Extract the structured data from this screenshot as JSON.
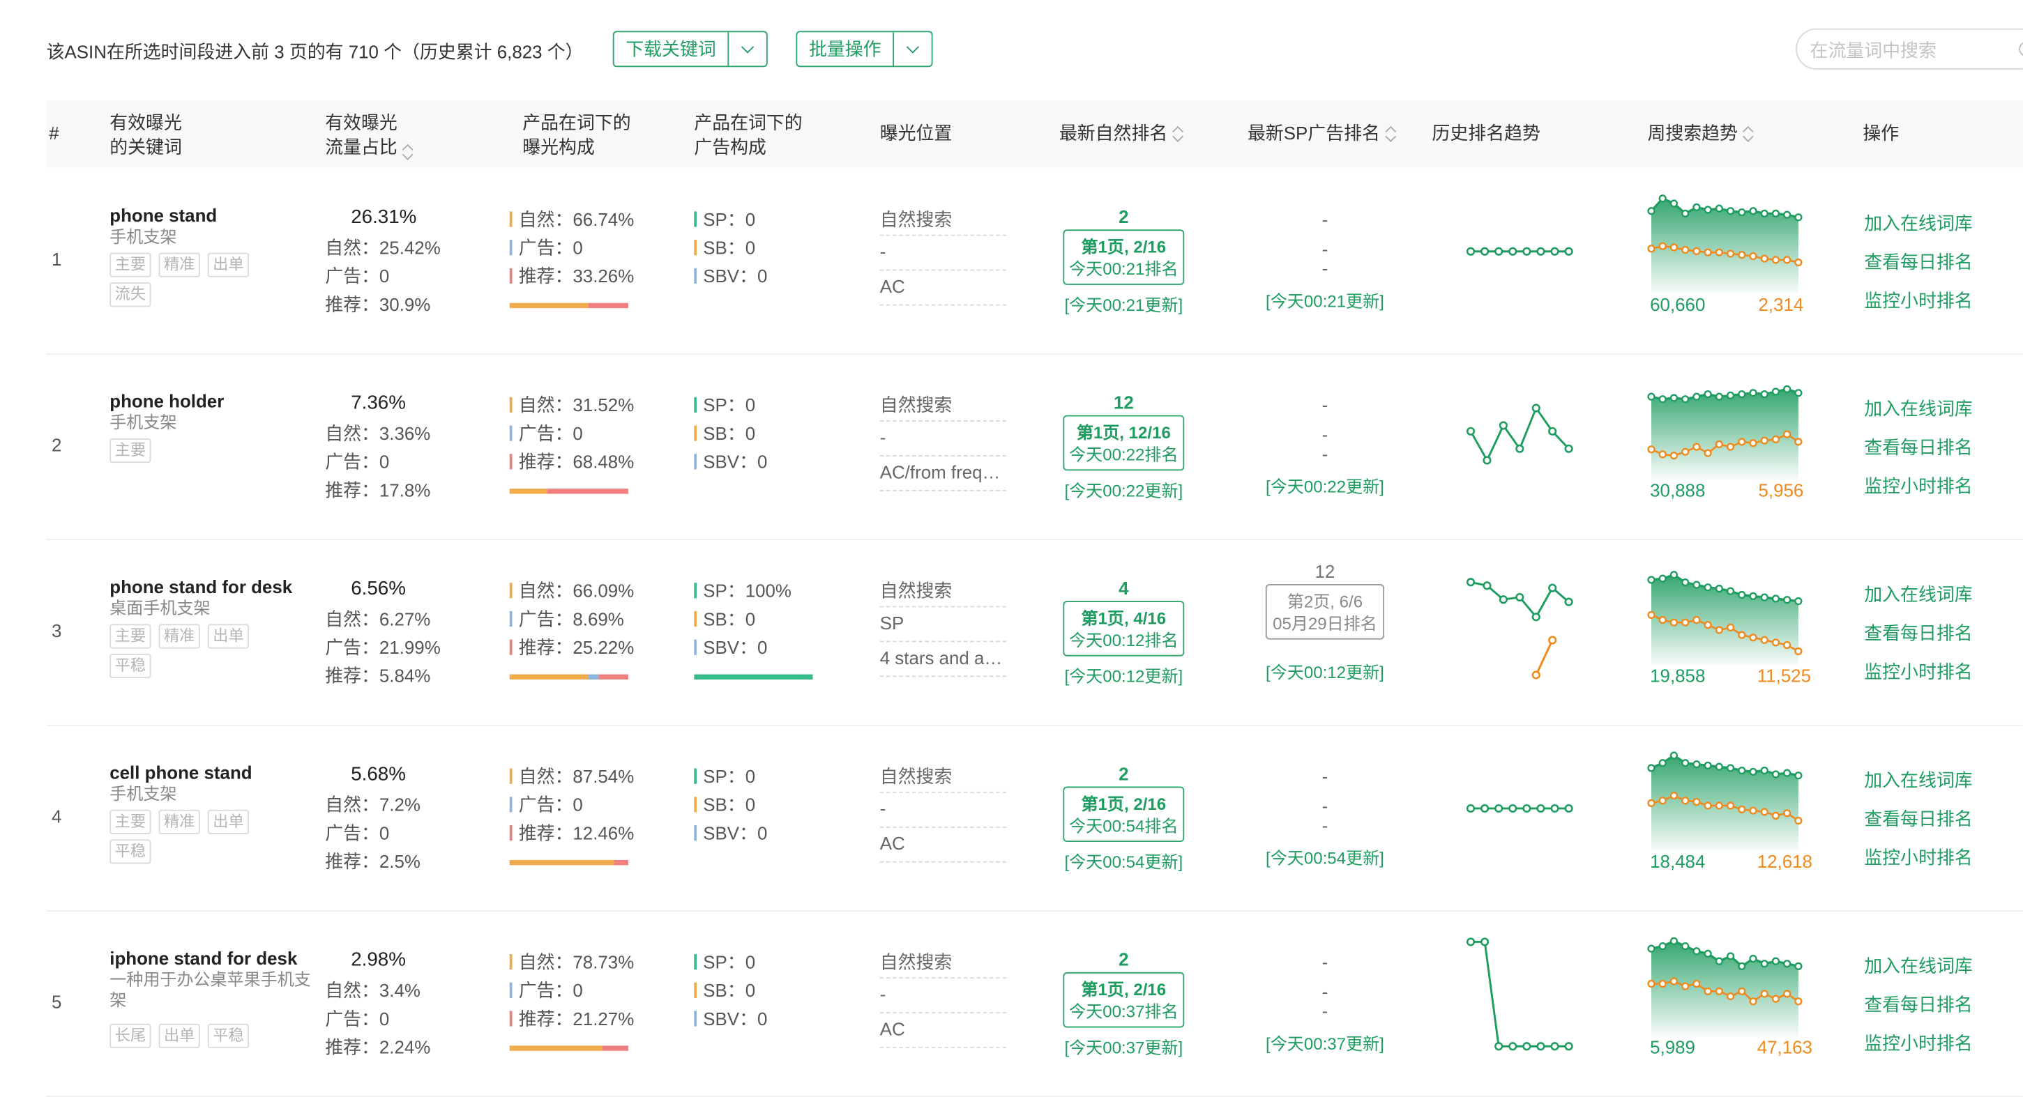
{
  "toolbar": {
    "summary": "该ASIN在所选时间段进入前 3 页的有 710 个（历史累计 6,823 个）",
    "download_label": "下载关键词",
    "batch_label": "批量操作",
    "search_placeholder": "在流量词中搜索"
  },
  "columns": {
    "index": "#",
    "keyword": "有效曝光\n的关键词",
    "share": "有效曝光\n流量占比",
    "exposure": "产品在词下的\n曝光构成",
    "ads": "产品在词下的\n广告构成",
    "position": "曝光位置",
    "organic_rank": "最新自然排名",
    "sp_rank": "最新SP广告排名",
    "history": "历史排名趋势",
    "weekly": "周搜索趋势",
    "actions": "操作"
  },
  "colors": {
    "accent": "#1f9d60",
    "orange": "#ee8a1e",
    "organic": "#f0ab4a",
    "ad": "#8fb4df",
    "recommend": "#f08080",
    "sp_bar": "#37bb8a"
  },
  "rows": [
    {
      "index": "1",
      "keyword": "phone stand",
      "keyword_cn": "手机支架",
      "tags": [
        "主要",
        "精准",
        "出单",
        "流失"
      ],
      "share": "26.31%",
      "share_natural": "自然：25.42%",
      "share_ad": "广告：0",
      "share_rec": "推荐：30.9%",
      "exp_natural": "自然：66.74%",
      "exp_ad": "广告：0",
      "exp_rec": "推荐：33.26%",
      "exp_values": [
        66.74,
        0,
        33.26
      ],
      "sp": "SP：0",
      "sb": "SB：0",
      "sbv": "SBV：0",
      "sp_share": 0,
      "positions": [
        "自然搜索",
        "-",
        "AC"
      ],
      "organic_rank": "2",
      "organic_page": "第1页, 2/16",
      "organic_time": "今天00:21排名",
      "organic_updated": "[今天00:21更新]",
      "sp_rank_lines": [
        "-",
        "-",
        "-"
      ],
      "sp_updated": "[今天00:21更新]",
      "history_green": [
        0.5,
        0.5,
        0.5,
        0.5,
        0.5,
        0.5,
        0.5,
        0.5
      ],
      "history_orange": [],
      "weekly_green": [
        60,
        70,
        66,
        58,
        63,
        61,
        62,
        60,
        59,
        60,
        58,
        58,
        57,
        55
      ],
      "weekly_orange": [
        30,
        32,
        31,
        29,
        28,
        27,
        27,
        26,
        25,
        24,
        22,
        21,
        21,
        19
      ],
      "weekly_volume": "60,660",
      "weekly_rank": "2,314",
      "actions": [
        "加入在线词库",
        "查看每日排名",
        "监控小时排名"
      ]
    },
    {
      "index": "2",
      "keyword": "phone holder",
      "keyword_cn": "手机支架",
      "tags": [
        "主要"
      ],
      "share": "7.36%",
      "share_natural": "自然：3.36%",
      "share_ad": "广告：0",
      "share_rec": "推荐：17.8%",
      "exp_natural": "自然：31.52%",
      "exp_ad": "广告：0",
      "exp_rec": "推荐：68.48%",
      "exp_values": [
        31.52,
        0,
        68.48
      ],
      "sp": "SP：0",
      "sb": "SB：0",
      "sbv": "SBV：0",
      "sp_share": 0,
      "positions": [
        "自然搜索",
        "-",
        "AC/from freq…"
      ],
      "organic_rank": "12",
      "organic_page": "第1页, 12/16",
      "organic_time": "今天00:22排名",
      "organic_updated": "[今天00:22更新]",
      "sp_rank_lines": [
        "-",
        "-",
        "-"
      ],
      "sp_updated": "[今天00:22更新]",
      "history_green": [
        0.55,
        0.3,
        0.6,
        0.4,
        0.75,
        0.55,
        0.4
      ],
      "history_orange": [],
      "weekly_green": [
        60,
        58,
        59,
        58,
        60,
        62,
        60,
        61,
        62,
        63,
        62,
        64,
        66,
        63
      ],
      "weekly_orange": [
        18,
        14,
        13,
        16,
        20,
        15,
        22,
        20,
        24,
        23,
        25,
        26,
        30,
        24
      ],
      "weekly_volume": "30,888",
      "weekly_rank": "5,956",
      "actions": [
        "加入在线词库",
        "查看每日排名",
        "监控小时排名"
      ]
    },
    {
      "index": "3",
      "keyword": "phone stand for desk",
      "keyword_cn": "桌面手机支架",
      "tags": [
        "主要",
        "精准",
        "出单",
        "平稳"
      ],
      "share": "6.56%",
      "share_natural": "自然：6.27%",
      "share_ad": "广告：21.99%",
      "share_rec": "推荐：5.84%",
      "exp_natural": "自然：66.09%",
      "exp_ad": "广告：8.69%",
      "exp_rec": "推荐：25.22%",
      "exp_values": [
        66.09,
        8.69,
        25.22
      ],
      "sp": "SP：100%",
      "sb": "SB：0",
      "sbv": "SBV：0",
      "sp_share": 100,
      "positions": [
        "自然搜索",
        "SP",
        "4 stars and a…"
      ],
      "organic_rank": "4",
      "organic_page": "第1页, 4/16",
      "organic_time": "今天00:12排名",
      "organic_updated": "[今天00:12更新]",
      "sp_rank": "12",
      "sp_page": "第2页, 6/6",
      "sp_time": "05月29日排名",
      "sp_updated": "[今天00:12更新]",
      "history_green": [
        0.85,
        0.82,
        0.7,
        0.72,
        0.55,
        0.8,
        0.68
      ],
      "history_orange": [
        0,
        0,
        0,
        0,
        0.05,
        0.35,
        0
      ],
      "weekly_green": [
        62,
        63,
        66,
        60,
        58,
        56,
        55,
        53,
        50,
        49,
        48,
        47,
        46,
        45
      ],
      "weekly_orange": [
        34,
        30,
        28,
        28,
        30,
        26,
        22,
        24,
        18,
        16,
        14,
        12,
        10,
        5
      ],
      "weekly_volume": "19,858",
      "weekly_rank": "11,525",
      "actions": [
        "加入在线词库",
        "查看每日排名",
        "监控小时排名"
      ]
    },
    {
      "index": "4",
      "keyword": "cell phone stand",
      "keyword_cn": "手机支架",
      "tags": [
        "主要",
        "精准",
        "出单",
        "平稳"
      ],
      "share": "5.68%",
      "share_natural": "自然：7.2%",
      "share_ad": "广告：0",
      "share_rec": "推荐：2.5%",
      "exp_natural": "自然：87.54%",
      "exp_ad": "广告：0",
      "exp_rec": "推荐：12.46%",
      "exp_values": [
        87.54,
        0,
        12.46
      ],
      "sp": "SP：0",
      "sb": "SB：0",
      "sbv": "SBV：0",
      "sp_share": 0,
      "positions": [
        "自然搜索",
        "-",
        "AC"
      ],
      "organic_rank": "2",
      "organic_page": "第1页, 2/16",
      "organic_time": "今天00:54排名",
      "organic_updated": "[今天00:54更新]",
      "sp_rank_lines": [
        "-",
        "-",
        "-"
      ],
      "sp_updated": "[今天00:54更新]",
      "history_green": [
        0.5,
        0.5,
        0.5,
        0.5,
        0.5,
        0.5,
        0.5,
        0.5
      ],
      "history_orange": [],
      "weekly_green": [
        60,
        64,
        70,
        64,
        63,
        62,
        61,
        60,
        58,
        57,
        58,
        55,
        56,
        54
      ],
      "weekly_orange": [
        32,
        34,
        38,
        34,
        33,
        30,
        30,
        30,
        27,
        26,
        25,
        22,
        24,
        18
      ],
      "weekly_volume": "18,484",
      "weekly_rank": "12,618",
      "actions": [
        "加入在线词库",
        "查看每日排名",
        "监控小时排名"
      ]
    },
    {
      "index": "5",
      "keyword": "iphone stand for desk",
      "keyword_cn": "一种用于办公桌苹果手机支架",
      "tags": [
        "长尾",
        "出单",
        "平稳"
      ],
      "share": "2.98%",
      "share_natural": "自然：3.4%",
      "share_ad": "广告：0",
      "share_rec": "推荐：2.24%",
      "exp_natural": "自然：78.73%",
      "exp_ad": "广告：0",
      "exp_rec": "推荐：21.27%",
      "exp_values": [
        78.73,
        0,
        21.27
      ],
      "sp": "SP：0",
      "sb": "SB：0",
      "sbv": "SBV：0",
      "sp_share": 0,
      "positions": [
        "自然搜索",
        "-",
        "AC"
      ],
      "organic_rank": "2",
      "organic_page": "第1页, 2/16",
      "organic_time": "今天00:37排名",
      "organic_updated": "[今天00:37更新]",
      "sp_rank_lines": [
        "-",
        "-",
        "-"
      ],
      "sp_updated": "[今天00:37更新]",
      "history_green": [
        0.95,
        0.95,
        0.05,
        0.05,
        0.05,
        0.05,
        0.05,
        0.05
      ],
      "history_orange": [],
      "weekly_green": [
        64,
        66,
        70,
        66,
        62,
        60,
        54,
        58,
        50,
        56,
        52,
        54,
        52,
        50
      ],
      "weekly_orange": [
        36,
        36,
        38,
        34,
        36,
        30,
        30,
        26,
        30,
        22,
        28,
        24,
        28,
        22
      ],
      "weekly_volume": "5,989",
      "weekly_rank": "47,163",
      "actions": [
        "加入在线词库",
        "查看每日排名",
        "监控小时排名"
      ]
    }
  ]
}
